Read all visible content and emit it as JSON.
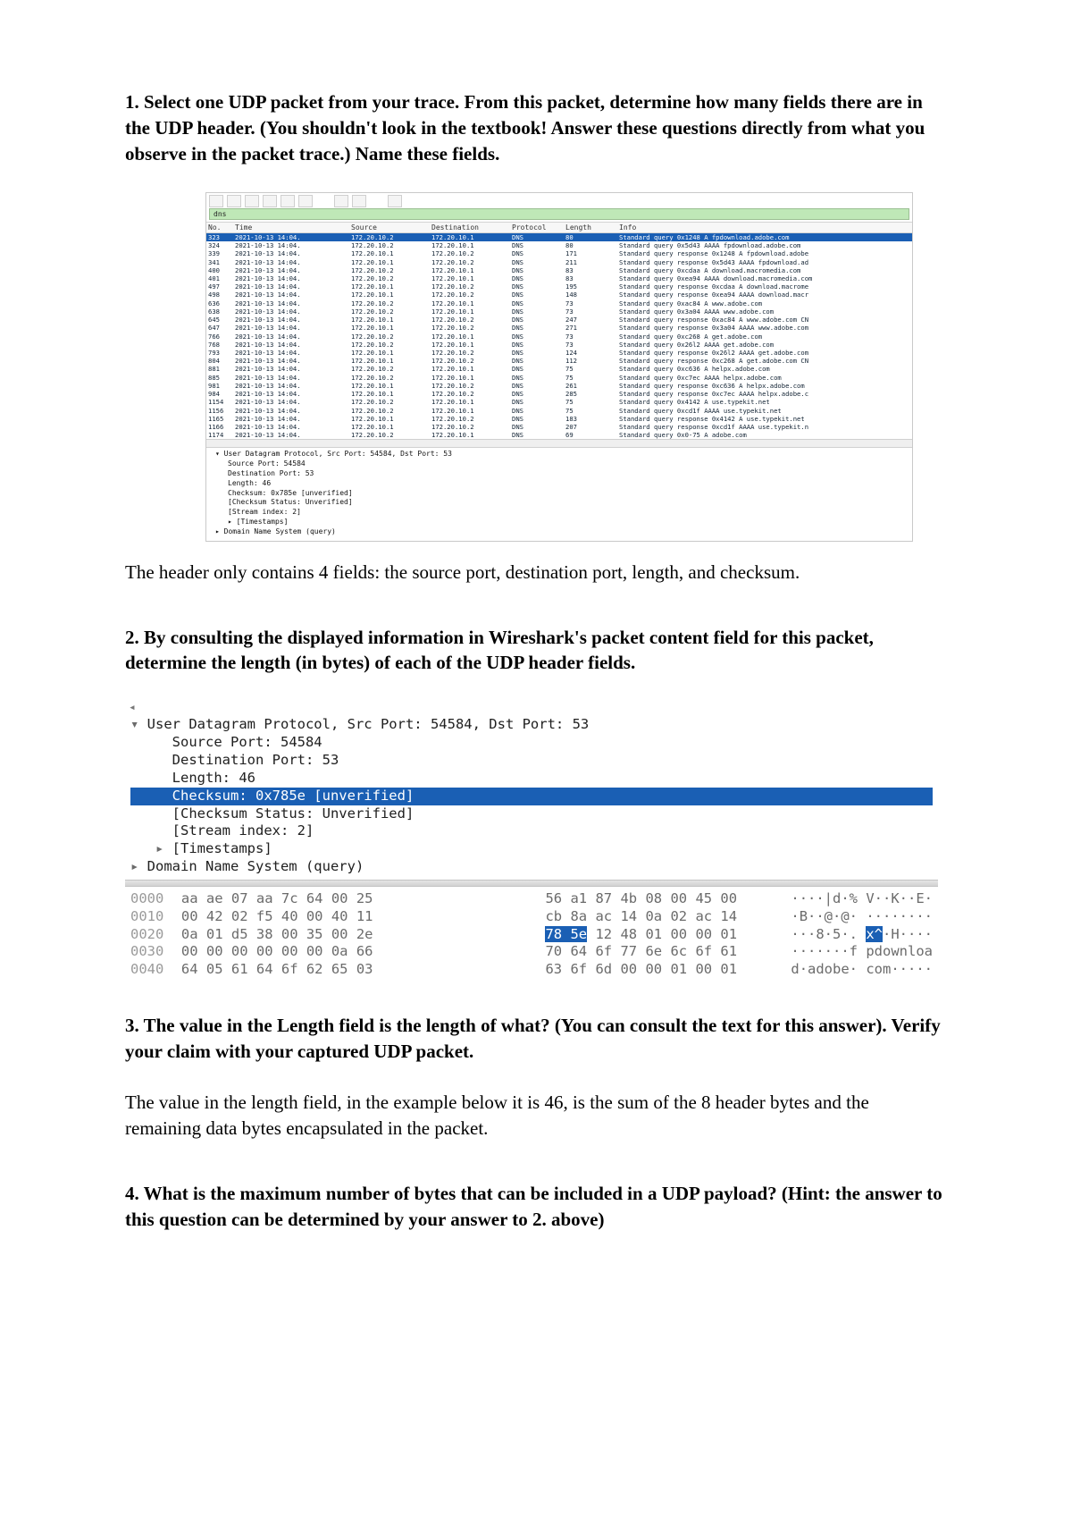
{
  "q1": "1. Select one UDP packet from your trace. From this packet, determine how many fields there are in the UDP header. (You shouldn't look in the textbook! Answer these questions directly from what you observe in the packet trace.) Name these fields.",
  "a1": "The header only contains 4 fields: the source port, destination port, length, and checksum.",
  "q2": "2. By consulting the displayed information in Wireshark's packet content field for this packet, determine the length (in bytes) of each of the UDP header fields.",
  "q3": "3. The value in the Length field is the length of what? (You can consult the text for this answer). Verify your claim with your captured UDP packet.",
  "a3": "The value in the length field, in the example below it is 46, is the sum of the 8 header bytes and the remaining data bytes encapsulated in the packet.",
  "q4": "4. What is the maximum number of bytes that can be included in a UDP payload? (Hint: the answer to this question can be determined by your answer to 2. above)",
  "ws": {
    "filter": "dns",
    "cols": [
      "No.",
      "Time",
      "Source",
      "Destination",
      "Protocol",
      "Length",
      "Info"
    ],
    "rows": [
      {
        "sel": true,
        "no": "323",
        "time": "2021-10-13 14:04.",
        "src": "172.20.10.2",
        "dst": "172.20.10.1",
        "proto": "DNS",
        "len": "80",
        "info": "Standard query 0x1248 A fpdownload.adobe.com"
      },
      {
        "no": "324",
        "time": "2021-10-13 14:04.",
        "src": "172.20.10.2",
        "dst": "172.20.10.1",
        "proto": "DNS",
        "len": "80",
        "info": "Standard query 0x5d43 AAAA fpdownload.adobe.com"
      },
      {
        "no": "339",
        "time": "2021-10-13 14:04.",
        "src": "172.20.10.1",
        "dst": "172.20.10.2",
        "proto": "DNS",
        "len": "171",
        "info": "Standard query response 0x1248 A fpdownload.adobe"
      },
      {
        "no": "341",
        "time": "2021-10-13 14:04.",
        "src": "172.20.10.1",
        "dst": "172.20.10.2",
        "proto": "DNS",
        "len": "211",
        "info": "Standard query response 0x5d43 AAAA fpdownload.ad"
      },
      {
        "no": "400",
        "time": "2021-10-13 14:04.",
        "src": "172.20.10.2",
        "dst": "172.20.10.1",
        "proto": "DNS",
        "len": "83",
        "info": "Standard query 0xcdaa A download.macromedia.com"
      },
      {
        "no": "401",
        "time": "2021-10-13 14:04.",
        "src": "172.20.10.2",
        "dst": "172.20.10.1",
        "proto": "DNS",
        "len": "83",
        "info": "Standard query 0xea94 AAAA download.macromedia.com"
      },
      {
        "no": "497",
        "time": "2021-10-13 14:04.",
        "src": "172.20.10.1",
        "dst": "172.20.10.2",
        "proto": "DNS",
        "len": "195",
        "info": "Standard query response 0xcdaa A download.macrome"
      },
      {
        "no": "498",
        "time": "2021-10-13 14:04.",
        "src": "172.20.10.1",
        "dst": "172.20.10.2",
        "proto": "DNS",
        "len": "148",
        "info": "Standard query response 0xea94 AAAA download.macr"
      },
      {
        "no": "636",
        "time": "2021-10-13 14:04.",
        "src": "172.20.10.2",
        "dst": "172.20.10.1",
        "proto": "DNS",
        "len": "73",
        "info": "Standard query 0xac84 A www.adobe.com"
      },
      {
        "no": "638",
        "time": "2021-10-13 14:04.",
        "src": "172.20.10.2",
        "dst": "172.20.10.1",
        "proto": "DNS",
        "len": "73",
        "info": "Standard query 0x3a04 AAAA www.adobe.com"
      },
      {
        "no": "645",
        "time": "2021-10-13 14:04.",
        "src": "172.20.10.1",
        "dst": "172.20.10.2",
        "proto": "DNS",
        "len": "247",
        "info": "Standard query response 0xac84 A www.adobe.com CN"
      },
      {
        "no": "647",
        "time": "2021-10-13 14:04.",
        "src": "172.20.10.1",
        "dst": "172.20.10.2",
        "proto": "DNS",
        "len": "271",
        "info": "Standard query response 0x3a04 AAAA www.adobe.com"
      },
      {
        "no": "766",
        "time": "2021-10-13 14:04.",
        "src": "172.20.10.2",
        "dst": "172.20.10.1",
        "proto": "DNS",
        "len": "73",
        "info": "Standard query 0xc268 A get.adobe.com"
      },
      {
        "no": "768",
        "time": "2021-10-13 14:04.",
        "src": "172.20.10.2",
        "dst": "172.20.10.1",
        "proto": "DNS",
        "len": "73",
        "info": "Standard query 0x26l2 AAAA get.adobe.com"
      },
      {
        "no": "793",
        "time": "2021-10-13 14:04.",
        "src": "172.20.10.1",
        "dst": "172.20.10.2",
        "proto": "DNS",
        "len": "124",
        "info": "Standard query response 0x26l2 AAAA get.adobe.com"
      },
      {
        "no": "804",
        "time": "2021-10-13 14:04.",
        "src": "172.20.10.1",
        "dst": "172.20.10.2",
        "proto": "DNS",
        "len": "112",
        "info": "Standard query response 0xc268 A get.adobe.com CN"
      },
      {
        "no": "881",
        "time": "2021-10-13 14:04.",
        "src": "172.20.10.2",
        "dst": "172.20.10.1",
        "proto": "DNS",
        "len": "75",
        "info": "Standard query 0xc636 A helpx.adobe.com"
      },
      {
        "no": "885",
        "time": "2021-10-13 14:04.",
        "src": "172.20.10.2",
        "dst": "172.20.10.1",
        "proto": "DNS",
        "len": "75",
        "info": "Standard query 0xc7ec AAAA helpx.adobe.com"
      },
      {
        "no": "981",
        "time": "2021-10-13 14:04.",
        "src": "172.20.10.1",
        "dst": "172.20.10.2",
        "proto": "DNS",
        "len": "261",
        "info": "Standard query response 0xc636 A helpx.adobe.com "
      },
      {
        "no": "984",
        "time": "2021-10-13 14:04.",
        "src": "172.20.10.1",
        "dst": "172.20.10.2",
        "proto": "DNS",
        "len": "285",
        "info": "Standard query response 0xc7ec AAAA helpx.adobe.c"
      },
      {
        "no": "1154",
        "time": "2021-10-13 14:04.",
        "src": "172.20.10.2",
        "dst": "172.20.10.1",
        "proto": "DNS",
        "len": "75",
        "info": "Standard query 0x4142 A use.typekit.net"
      },
      {
        "no": "1156",
        "time": "2021-10-13 14:04.",
        "src": "172.20.10.2",
        "dst": "172.20.10.1",
        "proto": "DNS",
        "len": "75",
        "info": "Standard query 0xcd1f AAAA use.typekit.net"
      },
      {
        "no": "1165",
        "time": "2021-10-13 14:04.",
        "src": "172.20.10.1",
        "dst": "172.20.10.2",
        "proto": "DNS",
        "len": "183",
        "info": "Standard query response 0x4142 A use.typekit.net "
      },
      {
        "no": "1166",
        "time": "2021-10-13 14:04.",
        "src": "172.20.10.1",
        "dst": "172.20.10.2",
        "proto": "DNS",
        "len": "207",
        "info": "Standard query response 0xcd1f AAAA use.typekit.n"
      },
      {
        "no": "1174",
        "time": "2021-10-13 14:04.",
        "src": "172.20.10.2",
        "dst": "172.20.10.1",
        "proto": "DNS",
        "len": "69",
        "info": "Standard query 0x0-75 A adobe.com"
      }
    ],
    "details_title": "User Datagram Protocol, Src Port: 54584, Dst Port: 53",
    "details": [
      "Source Port: 54584",
      "Destination Port: 53",
      "Length: 46",
      "Checksum: 0x785e [unverified]",
      "[Checksum Status: Unverified]",
      "[Stream index: 2]"
    ],
    "details_sub": "[Timestamps]",
    "details_dns": "Domain Name System (query)"
  },
  "ws2": {
    "title": "User Datagram Protocol, Src Port: 54584, Dst Port: 53",
    "lines": [
      "Source Port: 54584",
      "Destination Port: 53",
      "Length: 46"
    ],
    "sel_line": "Checksum: 0x785e [unverified]",
    "lines2": [
      "[Checksum Status: Unverified]",
      "[Stream index: 2]"
    ],
    "timestamps": "[Timestamps]",
    "dns": "Domain Name System (query)",
    "hex": [
      {
        "addr": "0000",
        "b1": "aa ae 07 aa 7c 64 00 25",
        "b2": "56 a1 87 4b 08 00 45 00",
        "asc": "····|d·% V··K··E·"
      },
      {
        "addr": "0010",
        "b1": "00 42 02 f5 40 00 40 11",
        "b2": "cb 8a ac 14 0a 02 ac 14",
        "asc": "·B··@·@· ········"
      },
      {
        "addr": "0020",
        "b1": "0a 01 d5 38 00 35 00 2e",
        "b2_pre": "",
        "hl": "78 5e",
        "b2_post": " 12 48 01 00 00 01",
        "asc_pre": "···8·5·. ",
        "asc_hl": "x^",
        "asc_post": "·H····"
      },
      {
        "addr": "0030",
        "b1": "00 00 00 00 00 00 0a 66",
        "b2": "70 64 6f 77 6e 6c 6f 61",
        "asc": "·······f pdownloa"
      },
      {
        "addr": "0040",
        "b1": "64 05 61 64 6f 62 65 03",
        "b2": "63 6f 6d 00 00 01 00 01",
        "asc": "d·adobe· com·····"
      }
    ]
  }
}
